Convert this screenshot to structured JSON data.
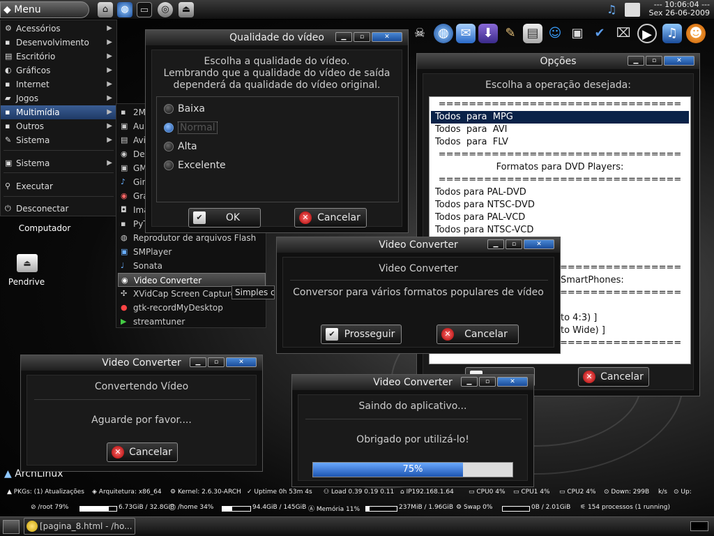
{
  "top_panel": {
    "menu_label": "Menu",
    "clock_time": "--- 10:06:04 ---",
    "clock_date": "Sex 26-06-2009"
  },
  "start_menu": {
    "items": [
      {
        "label": "Acessórios",
        "icon": "gear-icon",
        "arrow": true
      },
      {
        "label": "Desenvolvimento",
        "icon": "code-icon",
        "arrow": true
      },
      {
        "label": "Escritório",
        "icon": "office-icon",
        "arrow": true
      },
      {
        "label": "Gráficos",
        "icon": "graphics-icon",
        "arrow": true
      },
      {
        "label": "Internet",
        "icon": "globe-icon",
        "arrow": true
      },
      {
        "label": "Jogos",
        "icon": "gamepad-icon",
        "arrow": true
      },
      {
        "label": "Multimídia",
        "icon": "multimedia-icon",
        "arrow": true
      },
      {
        "label": "Outros",
        "icon": "folder-icon",
        "arrow": true
      },
      {
        "label": "Sistema",
        "icon": "tools-icon",
        "arrow": true
      },
      {
        "label": "Sistema",
        "icon": "system-icon",
        "arrow": true
      },
      {
        "label": "Executar",
        "icon": "run-icon",
        "arrow": false
      },
      {
        "label": "Desconectar",
        "icon": "power-icon",
        "arrow": false
      }
    ]
  },
  "submenu": {
    "items": [
      {
        "label": "2M"
      },
      {
        "label": "Au"
      },
      {
        "label": "Avi"
      },
      {
        "label": "Dev"
      },
      {
        "label": "GM"
      },
      {
        "label": "Gin"
      },
      {
        "label": "Gra"
      },
      {
        "label": "Ima"
      },
      {
        "label": "PyT"
      },
      {
        "label": "Reprodutor de arquivos Flash"
      },
      {
        "label": "SMPlayer"
      },
      {
        "label": "Sonata"
      },
      {
        "label": "Video Converter"
      },
      {
        "label": "XVidCap Screen Capture"
      },
      {
        "label": "gtk-recordMyDesktop"
      },
      {
        "label": "streamtuner"
      }
    ],
    "tooltip": "Simples c"
  },
  "desktop": {
    "computer_label": "Computador",
    "pendrive_label": "Pendrive",
    "arch_logo_text": "ArchLinux"
  },
  "quality_window": {
    "title": "Qualidade do vídeo",
    "prompt_line1": "Escolha a qualidade do vídeo.",
    "prompt_line2": "Lembrando que a qualidade do vídeo de saída",
    "prompt_line3": "dependerá da qualidade do vídeo original.",
    "options": [
      "Baixa",
      "Normal",
      "Alta",
      "Excelente"
    ],
    "selected_option": "Normal",
    "ok_label": "OK",
    "cancel_label": "Cancelar"
  },
  "options_window": {
    "title": "Opções",
    "prompt": "Escolha a operação desejada:",
    "lines": [
      "================================",
      "Todos  para  MPG",
      "Todos  para  AVI",
      "Todos  para  FLV",
      "================================",
      "Formatos para DVD Players:",
      "================================",
      "Todos para PAL-DVD",
      "Todos para NTSC-DVD",
      "Todos para PAL-VCD",
      "Todos para NTSC-VCD",
      "",
      "",
      "================================",
      "SmartPhones:",
      "================================",
      "",
      "to 4:3) ]",
      "to Wide) ]",
      "================================"
    ],
    "selected_line": "Todos  para  MPG",
    "cancel_label": "Cancelar"
  },
  "intro_window": {
    "title": "Video Converter",
    "heading": "Video Converter",
    "description": "Conversor para vários formatos populares de vídeo",
    "continue_label": "Prosseguir",
    "cancel_label": "Cancelar"
  },
  "converting_window": {
    "title": "Video Converter",
    "heading": "Convertendo Vídeo",
    "message": "Aguarde por favor....",
    "cancel_label": "Cancelar"
  },
  "exit_window": {
    "title": "Video Converter",
    "heading": "Saindo do aplicativo...",
    "message": "Obrigado por utilizá-lo!",
    "progress_text": "75%",
    "progress_value": 0.75
  },
  "conky": {
    "pkgs": "PKGs: (1) Atualizações",
    "arch": "Arquitetura: x86_64",
    "kernel": "Kernel: 2.6.30-ARCH",
    "uptime": "Uptime 0h 53m 4s",
    "load": "Load 0.39 0.19 0.11",
    "ip": "IP192.168.1.64",
    "cpu0": "CPU0 4%",
    "cpu1": "CPU1 4%",
    "cpu2": "CPU2 4%",
    "down": "Down: 299B",
    "kbs": "k/s",
    "up": "Up:",
    "root": "/root  79%",
    "root_val": 0.79,
    "root_size": "6.73GiB / 32.8GiB",
    "home": "/home  34%",
    "home_val": 0.34,
    "home_size": "94.4GiB / 145GiB",
    "mem": "Memória  11%",
    "mem_val": 0.11,
    "mem_size": "237MiB / 1.96GiB",
    "swap": "Swap  0%",
    "swap_val": 0.0,
    "swap_size": "0B   / 2.01GiB",
    "procs": "154 processos (1 running)"
  },
  "taskbar": {
    "task_label": "[pagina_8.html - /ho..."
  },
  "colors": {
    "accent": "#1f3a66",
    "selection": "#0a2248",
    "close_button": "#1a4c9a"
  }
}
